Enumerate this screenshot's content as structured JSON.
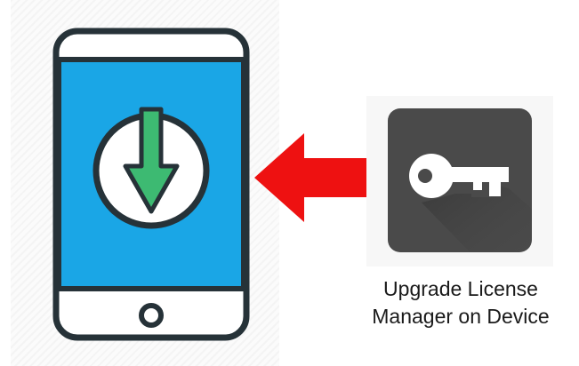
{
  "diagram": {
    "caption_line1": "Upgrade License",
    "caption_line2": "Manager on Device",
    "icons": {
      "phone": "smartphone-download-icon",
      "arrow": "left-arrow-icon",
      "key": "key-icon"
    },
    "colors": {
      "screen": "#1aa6e6",
      "download_arrow": "#3dba72",
      "outline": "#263238",
      "pointer_arrow": "#ee1111",
      "key_tile": "#4a4a4a",
      "key": "#ffffff"
    }
  }
}
